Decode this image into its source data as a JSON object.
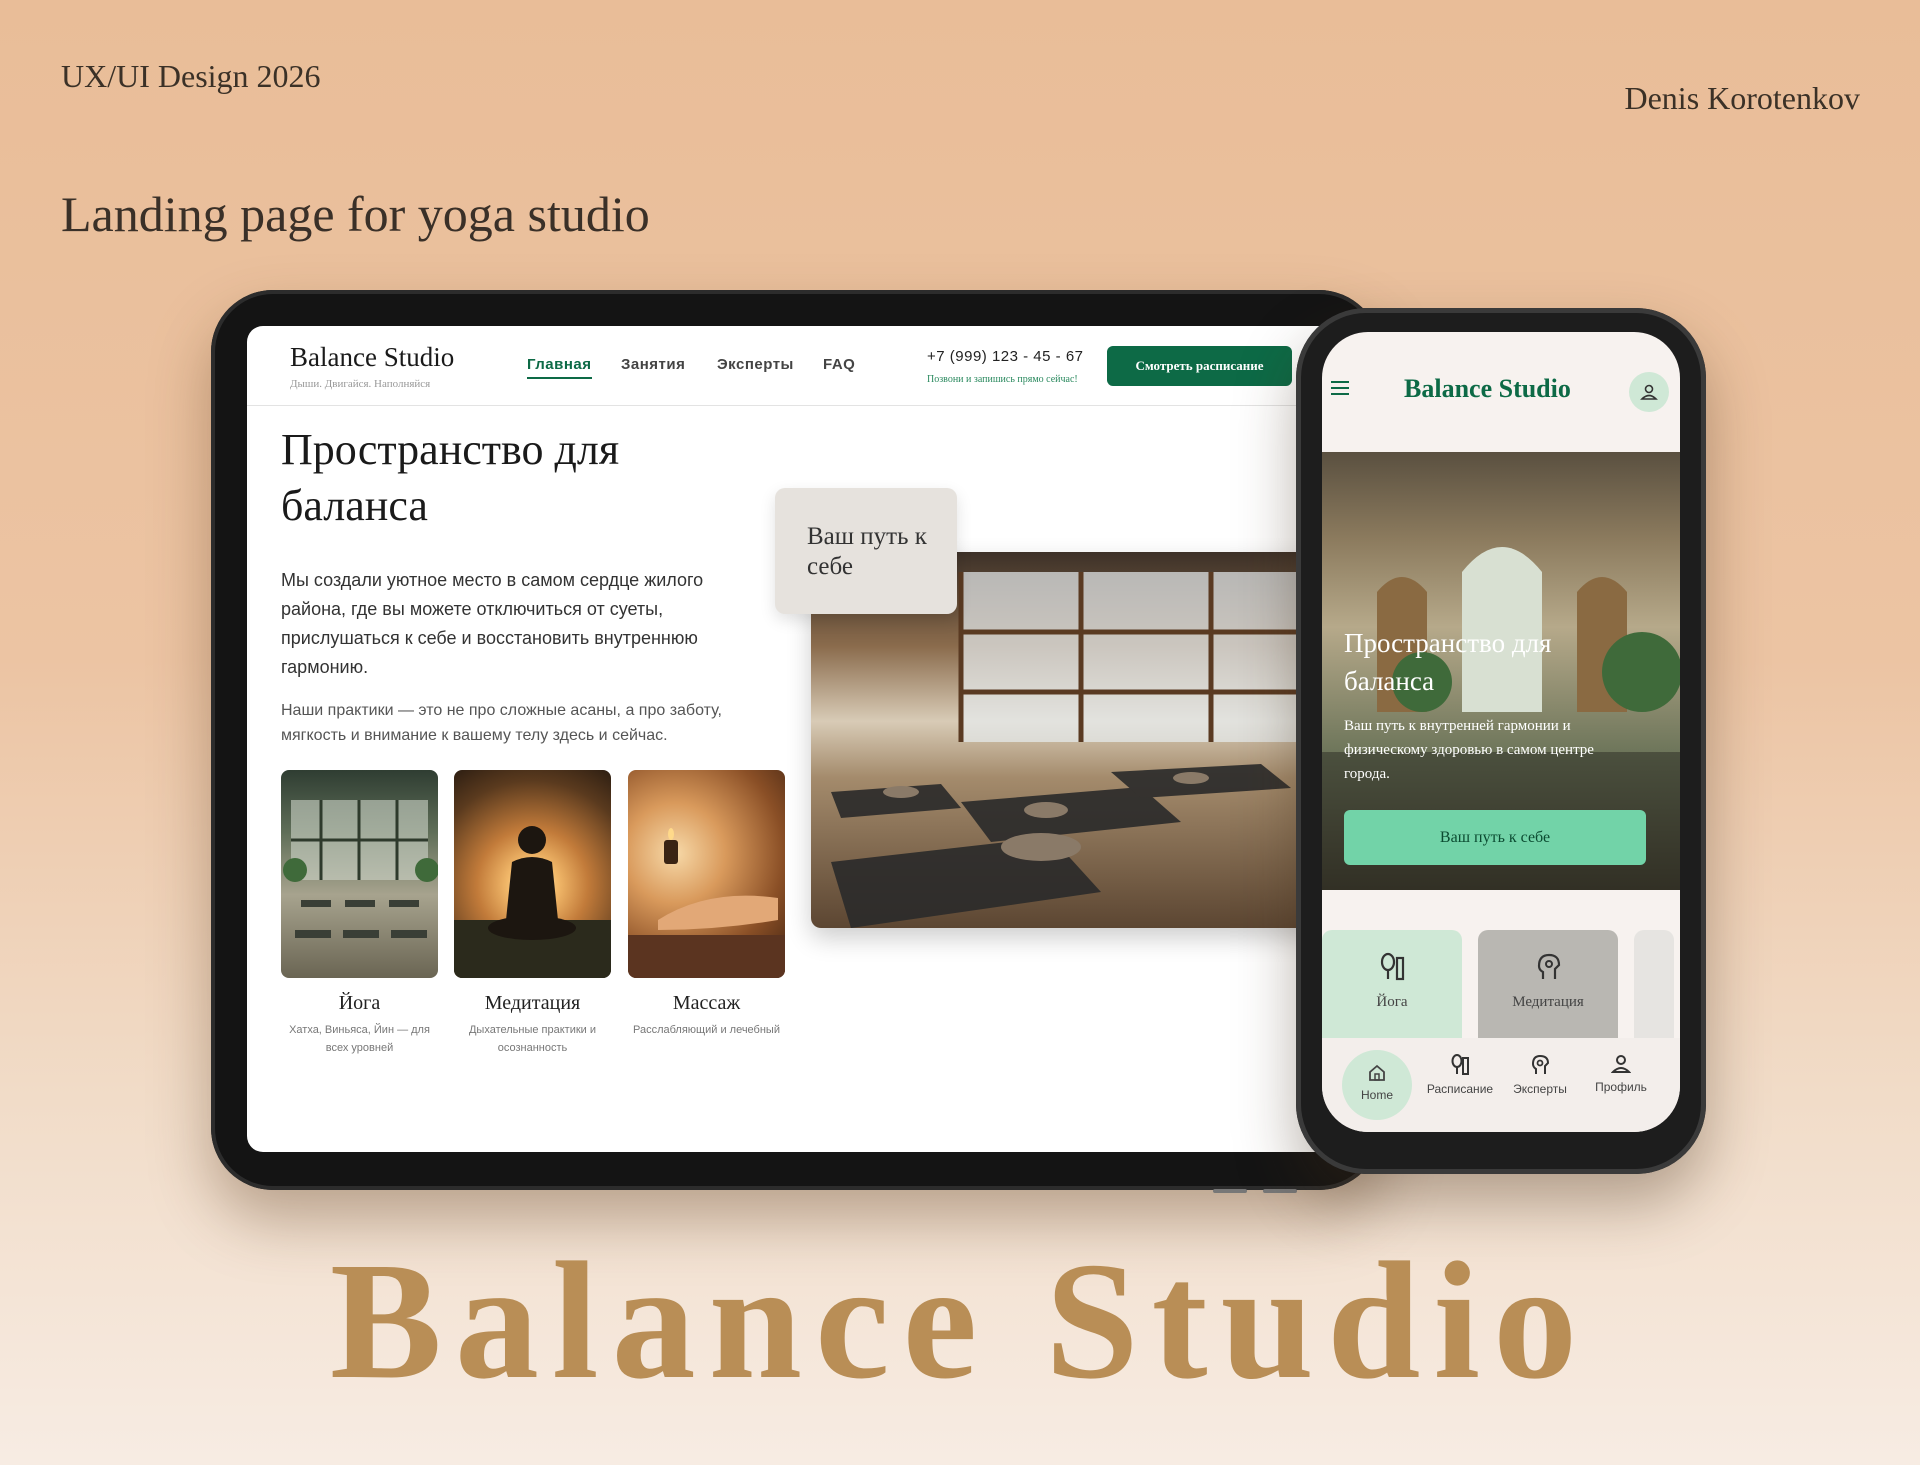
{
  "header": {
    "top_left": "UX/UI Design 2026",
    "top_right": "Denis Korotenkov",
    "title": "Landing page for yoga studio"
  },
  "brand_big": "Balance Studio",
  "tablet": {
    "logo": "Balance Studio",
    "tagline": "Дыши. Двигайся. Наполняйся",
    "nav": [
      "Главная",
      "Занятия",
      "Эксперты",
      "FAQ"
    ],
    "phone": "+7 (999) 123 - 45 - 67",
    "phone_note": "Позвони и запишись прямо сейчас!",
    "cta": "Смотреть расписание",
    "hero_title": "Пространство для баланса",
    "paragraph1": "Мы создали уютное место в самом сердце жилого района, где вы можете отключиться от суеты, прислушаться к себе и восстановить внутреннюю гармонию.",
    "paragraph2": "Наши практики — это не про сложные асаны, а про заботу, мягкость и внимание к вашему телу здесь и сейчас.",
    "badge": "Ваш путь к себе",
    "cards": [
      {
        "title": "Йога",
        "subtitle": "Хатха, Виньяса, Йин — для всех уровней"
      },
      {
        "title": "Медитация",
        "subtitle": "Дыхательные практики и осознанность"
      },
      {
        "title": "Массаж",
        "subtitle": "Расслабляющий и лечебный"
      }
    ]
  },
  "phone": {
    "logo": "Balance Studio",
    "hero_title": "Пространство для баланса",
    "hero_text": "Ваш путь к внутренней гармонии и физическому здоровью в самом центре города.",
    "cta": "Ваш путь к себе",
    "tiles": [
      "Йога",
      "Медитация"
    ],
    "tabs": [
      "Home",
      "Расписание",
      "Эксперты",
      "Профиль"
    ]
  },
  "colors": {
    "accent": "#0d6a46",
    "mint": "#72d3a8",
    "brand_gold": "#b98e56"
  }
}
